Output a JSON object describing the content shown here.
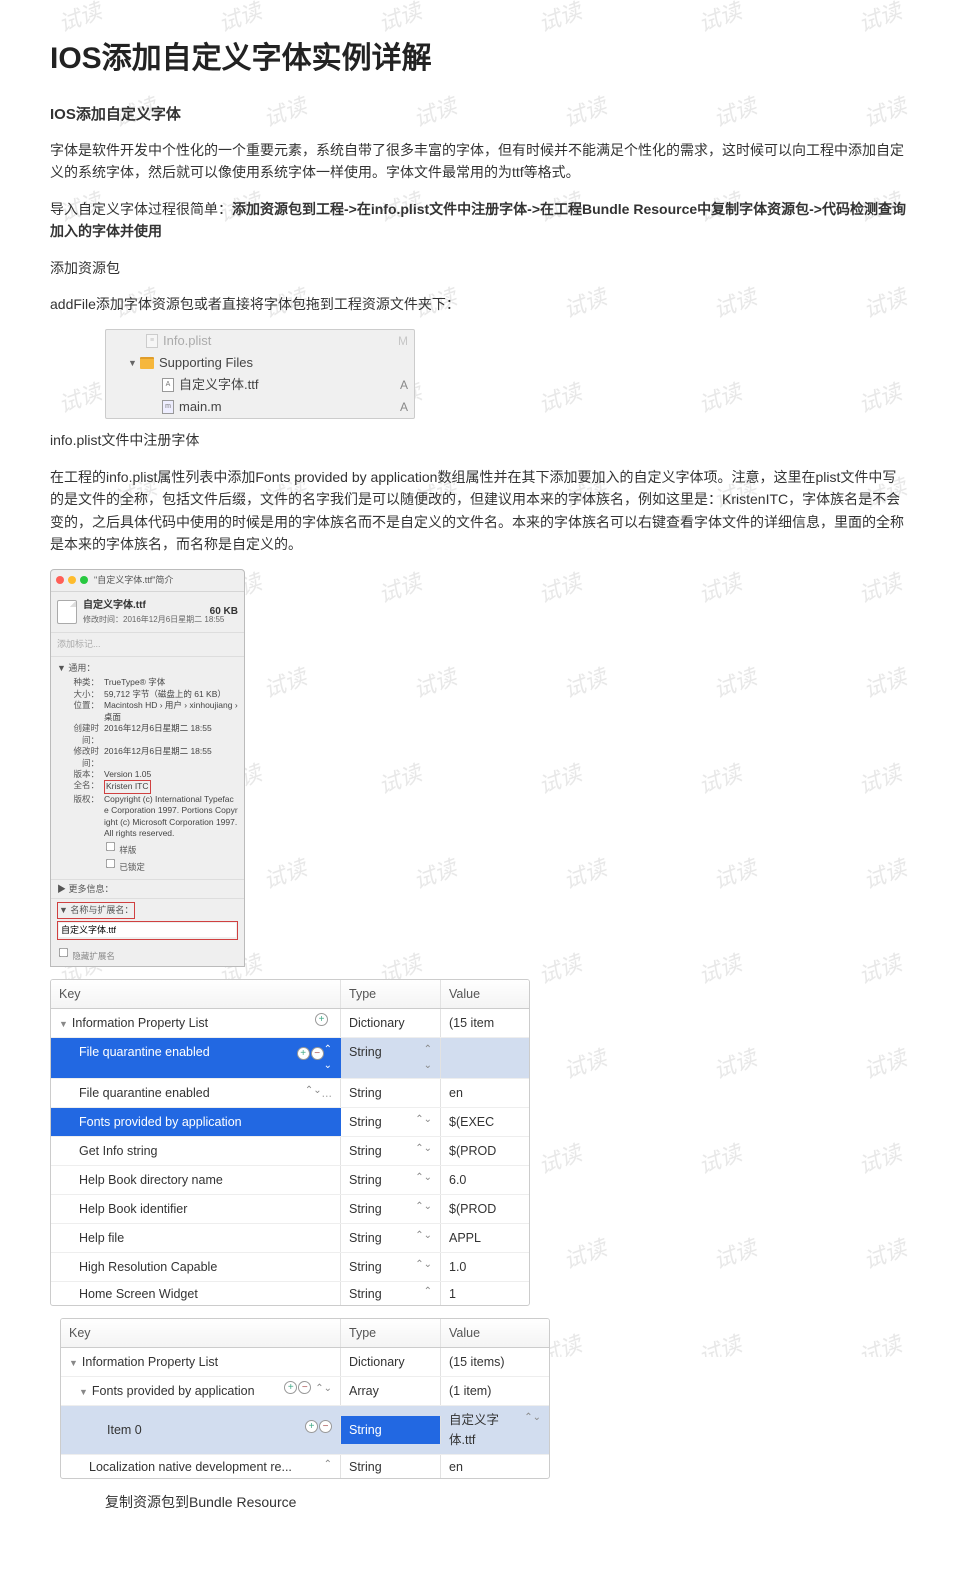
{
  "watermark": "试读",
  "title": "IOS添加自定义字体实例详解",
  "sub1": "IOS添加自定义字体",
  "para1": "字体是软件开发中个性化的一个重要元素，系统自带了很多丰富的字体，但有时候并不能满足个性化的需求，这时候可以向工程中添加自定义的系统字体，然后就可以像使用系统字体一样使用。字体文件最常用的为ttf等格式。",
  "para2_lead": "导入自定义字体过程很简单：",
  "para2_bold": "添加资源包到工程->在info.plist文件中注册字体->在工程Bundle Resource中复制字体资源包->代码检测查询加入的字体并使用",
  "sec_add": "添加资源包",
  "para_add": "addFile添加字体资源包或者直接将字体包拖到工程资源文件夹下：",
  "xcode": {
    "row0": "Info.plist",
    "row1": "Supporting Files",
    "row2": "自定义字体.ttf",
    "row3": "main.m",
    "letterA": "A",
    "letterM": "M"
  },
  "sec_reg": "info.plist文件中注册字体",
  "para_reg": "在工程的info.plist属性列表中添加Fonts provided by application数组属性并在其下添加要加入的自定义字体项。注意，这里在plist文件中写的是文件的全称，包括文件后缀，文件的名字我们是可以随便改的，但建议用本来的字体族名，例如这里是：KristenITC，字体族名是不会变的，之后具体代码中使用的时候是用的字体族名而不是自定义的文件名。本来的字体族名可以右键查看字体文件的详细信息，里面的全称是本来的字体族名，而名称是自定义的。",
  "info": {
    "window_title": "\"自定义字体.ttf\"简介",
    "filename": "自定义字体.ttf",
    "size": "60 KB",
    "modified": "修改时间：2016年12月6日星期二 18:55",
    "add_tag": "添加标记...",
    "general": "▼ 通用：",
    "kind_k": "种类：",
    "kind_v": "TrueType® 字体",
    "sz_k": "大小：",
    "sz_v": "59,712 字节（磁盘上的 61 KB）",
    "loc_k": "位置：",
    "loc_v": "Macintosh HD › 用户 › xinhoujiang › 桌面",
    "cr_k": "创建时间：",
    "cr_v": "2016年12月6日星期二 18:55",
    "md_k": "修改时间：",
    "md_v": "2016年12月6日星期二 18:55",
    "ver_k": "版本：",
    "ver_v": "Version 1.05",
    "full_k": "全名：",
    "full_v": "Kristen ITC",
    "cp_k": "版权：",
    "cp_v": "Copyright (c) International Typeface Corporation 1997. Portions Copyright (c) Microsoft Corporation 1997. All rights reserved.",
    "cb1": "样版",
    "cb2": "已锁定",
    "more": "▶ 更多信息：",
    "name_ext": "▼ 名称与扩展名：",
    "hide_ext": "隐藏扩展名"
  },
  "plist1": {
    "h_key": "Key",
    "h_type": "Type",
    "h_value": "Value",
    "r0_k": "Information Property List",
    "r0_t": "Dictionary",
    "r0_v": "(15 item",
    "r1_k": "File quarantine enabled",
    "r1_t": "String",
    "r1_v": "",
    "r2_k": "File quarantine enabled",
    "r2_t": "String",
    "r2_v": "en",
    "r3_k": "Fonts provided by application",
    "r3_t": "String",
    "r3_v": "$(EXEC",
    "r4_k": "Get Info string",
    "r4_t": "String",
    "r4_v": "$(PROD",
    "r5_k": "Help Book directory name",
    "r5_t": "String",
    "r5_v": "6.0",
    "r6_k": "Help Book identifier",
    "r6_t": "String",
    "r6_v": "$(PROD",
    "r7_k": "Help file",
    "r7_t": "String",
    "r7_v": "APPL",
    "r8_k": "High Resolution Capable",
    "r8_t": "String",
    "r8_v": "1.0",
    "r9_k": "Home Screen Widget",
    "r9_t": "String",
    "r9_v": "1"
  },
  "plist2": {
    "h_key": "Key",
    "h_type": "Type",
    "h_value": "Value",
    "r0_k": "Information Property List",
    "r0_t": "Dictionary",
    "r0_v": "(15 items)",
    "r1_k": "Fonts provided by application",
    "r1_t": "Array",
    "r1_v": "(1 item)",
    "r2_k": "Item 0",
    "r2_t": "String",
    "r2_v": "自定义字体.ttf",
    "r3_k": "Localization native development re...",
    "r3_t": "String",
    "r3_v": "en"
  },
  "caption": "复制资源包到Bundle Resource"
}
